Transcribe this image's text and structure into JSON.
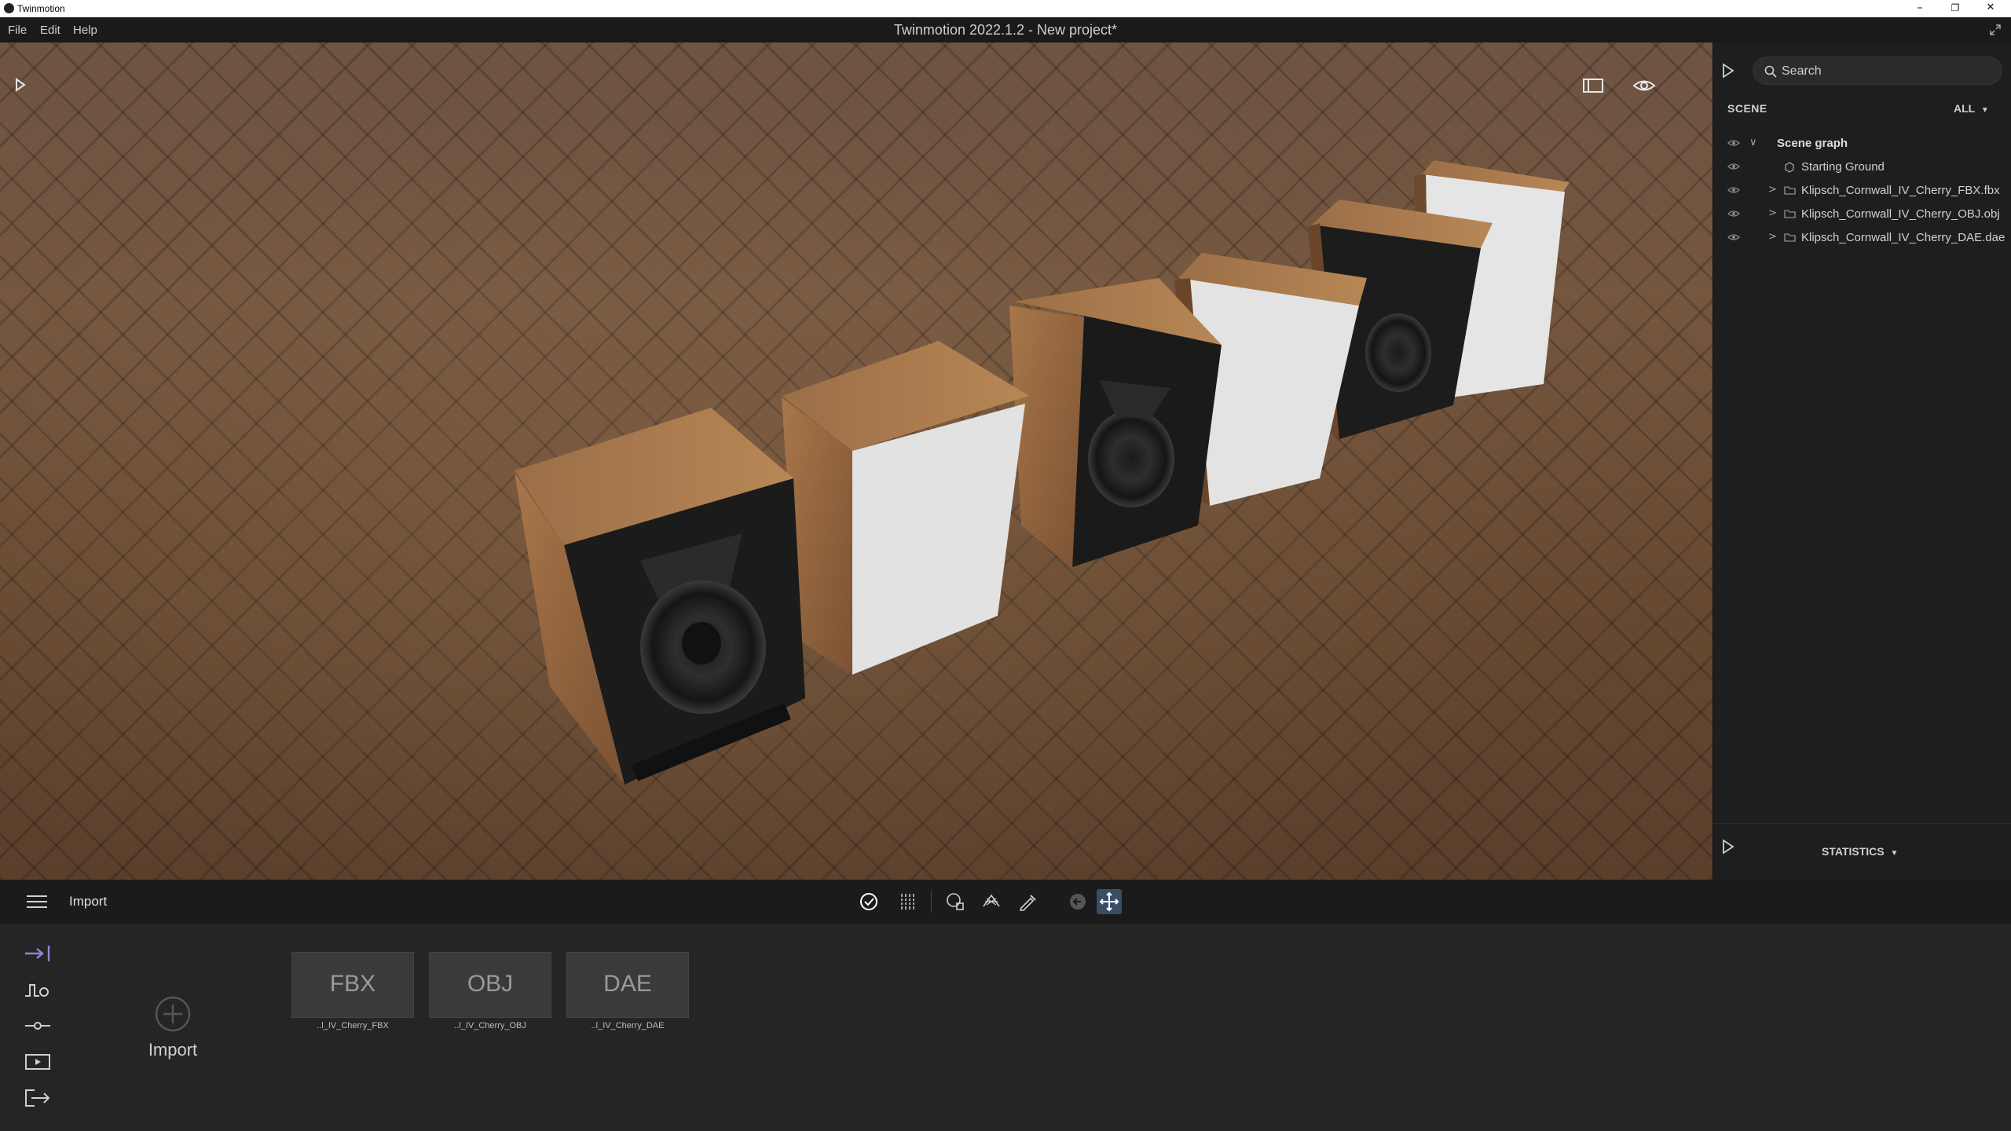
{
  "titlebar": {
    "app_name": "Twinmotion",
    "minimize": "–",
    "restore": "❐",
    "close": "✕"
  },
  "menubar": {
    "items": [
      "File",
      "Edit",
      "Help"
    ],
    "window_title": "Twinmotion 2022.1.2 - New project*"
  },
  "scene_panel": {
    "search_placeholder": "Search",
    "section_label": "SCENE",
    "filter_value": "ALL",
    "tree": [
      {
        "label": "Scene graph",
        "type": "root"
      },
      {
        "label": "Starting Ground",
        "type": "ground"
      },
      {
        "label": "Klipsch_Cornwall_IV_Cherry_FBX.fbx",
        "type": "folder"
      },
      {
        "label": "Klipsch_Cornwall_IV_Cherry_OBJ.obj",
        "type": "folder"
      },
      {
        "label": "Klipsch_Cornwall_IV_Cherry_DAE.dae",
        "type": "folder"
      }
    ],
    "statistics_label": "STATISTICS"
  },
  "toolbar": {
    "section_title": "Import",
    "tools": [
      "select-tool-icon",
      "grid-tool-icon",
      "lasso-tool-icon",
      "scatter-tool-icon",
      "eyedropper-icon",
      "undo-circle-icon",
      "move-gizmo-icon"
    ],
    "active_tool": "move-gizmo-icon"
  },
  "bottom_panel": {
    "side_icons": [
      "import-tab-icon",
      "context-tab-icon",
      "settings-tab-icon",
      "media-tab-icon",
      "export-tab-icon"
    ],
    "import_label": "Import",
    "imports": [
      {
        "format": "FBX",
        "caption": "..l_IV_Cherry_FBX"
      },
      {
        "format": "OBJ",
        "caption": "..l_IV_Cherry_OBJ"
      },
      {
        "format": "DAE",
        "caption": "..l_IV_Cherry_DAE"
      }
    ]
  },
  "colors": {
    "accent_purple": "#9a7fe0",
    "active_tool_bg": "#3b4c66",
    "panel_bg": "#1e1e1e"
  }
}
